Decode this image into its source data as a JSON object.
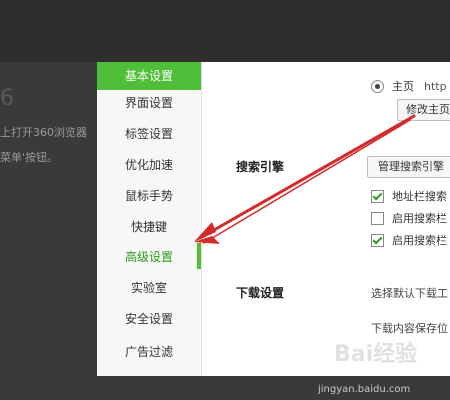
{
  "background": {
    "text_line1": "上打开360浏览器",
    "text_line2": "菜单'按钮。",
    "big_char": "6"
  },
  "sidebar": {
    "items": [
      {
        "label": "基本设置",
        "state": "active"
      },
      {
        "label": "界面设置",
        "state": ""
      },
      {
        "label": "标签设置",
        "state": ""
      },
      {
        "label": "优化加速",
        "state": ""
      },
      {
        "label": "鼠标手势",
        "state": ""
      },
      {
        "label": "快捷键",
        "state": ""
      },
      {
        "label": "高级设置",
        "state": "current"
      },
      {
        "label": "实验室",
        "state": ""
      },
      {
        "label": "安全设置",
        "state": ""
      },
      {
        "label": "广告过滤",
        "state": ""
      }
    ]
  },
  "startup": {
    "partial_text": "主页",
    "url_fragment": "http",
    "modify_homepage_button": "修改主页"
  },
  "search": {
    "label": "搜索引擎",
    "manage_button": "管理搜索引擎",
    "options": [
      {
        "label": "地址栏搜索",
        "checked": true
      },
      {
        "label": "启用搜索栏",
        "checked": false
      },
      {
        "label": "启用搜索栏",
        "checked": true
      }
    ]
  },
  "download": {
    "label": "下载设置",
    "line1": "选择默认下载工",
    "line2": "下载内容保存位"
  },
  "watermark": {
    "text": "jingyan.baidu.com",
    "logo": "Bai经验"
  },
  "colors": {
    "accent_green": "#4fbf3a",
    "arrow_red": "#d42a2a"
  }
}
